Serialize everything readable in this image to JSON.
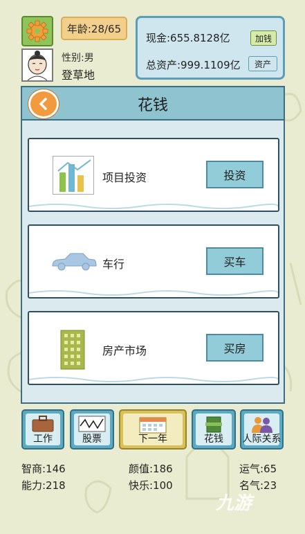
{
  "header": {
    "age": "年龄:28/65",
    "gender": "性别:男",
    "status": "登草地",
    "cash": "现金:655.8128亿",
    "cash_button": "加钱",
    "total_assets": "总资产:999.1109亿",
    "assets_button": "资产"
  },
  "dialog": {
    "title": "花钱",
    "options": [
      {
        "label": "项目投资",
        "button": "投资",
        "icon": "bar-chart-icon"
      },
      {
        "label": "车行",
        "button": "买车",
        "icon": "car-icon"
      },
      {
        "label": "房产市场",
        "button": "买房",
        "icon": "building-icon"
      }
    ]
  },
  "nav": {
    "items": [
      {
        "label": "工作",
        "icon": "briefcase-icon"
      },
      {
        "label": "股票",
        "icon": "stock-chart-icon"
      },
      {
        "label": "下一年",
        "icon": "calendar-icon"
      },
      {
        "label": "花钱",
        "icon": "money-icon"
      },
      {
        "label": "人际关系",
        "icon": "people-icon"
      }
    ]
  },
  "stats": {
    "iq": "智商:146",
    "looks": "颜值:186",
    "luck": "运气:65",
    "ability": "能力:218",
    "happiness": "快乐:100",
    "fame": "名气:23"
  },
  "watermark": "九游",
  "colors": {
    "background": "#e9ecd0",
    "dialog_header": "#8fc3cf",
    "button": "#92ccd8",
    "next_year": "#f3ecbe",
    "back_button": "#f29a3e"
  }
}
